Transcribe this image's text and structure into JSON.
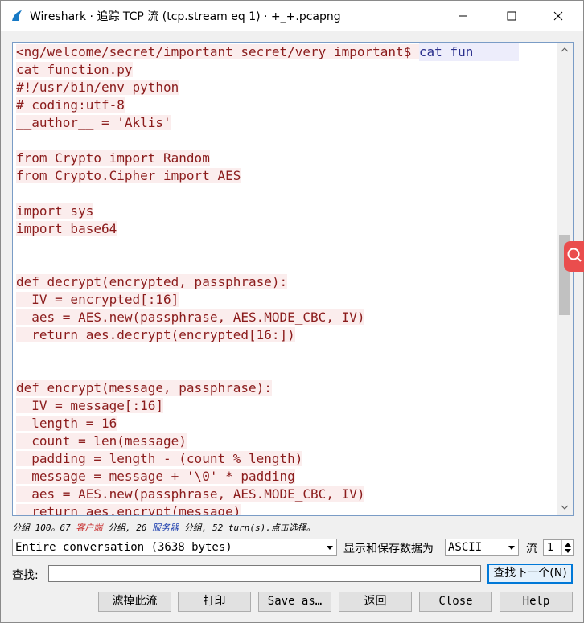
{
  "window": {
    "title": "Wireshark · 追踪 TCP 流 (tcp.stream eq 1) · +_+.pcapng",
    "icons": {
      "app": "wireshark-fin-icon",
      "minimize": "minimize-icon",
      "maximize": "maximize-icon",
      "close": "close-icon"
    }
  },
  "stream": {
    "first_line_client": "<ng/welcome/secret/important_secret/very_important$ ",
    "first_line_server": "cat fun",
    "lines": [
      "cat function.py",
      "#!/usr/bin/env python",
      "# coding:utf-8",
      "__author__ = 'Aklis'",
      "",
      "from Crypto import Random",
      "from Crypto.Cipher import AES",
      "",
      "import sys",
      "import base64",
      "",
      "",
      "def decrypt(encrypted, passphrase):",
      "  IV = encrypted[:16]",
      "  aes = AES.new(passphrase, AES.MODE_CBC, IV)",
      "  return aes.decrypt(encrypted[16:])",
      "",
      "",
      "def encrypt(message, passphrase):",
      "  IV = message[:16]",
      "  length = 16",
      "  count = len(message)",
      "  padding = length - (count % length)",
      "  message = message + '\\0' * padding",
      "  aes = AES.new(passphrase, AES.MODE_CBC, IV)",
      "  return aes.encrypt(message)"
    ],
    "colors": {
      "client_text": "#8b1c1c",
      "client_bg": "#fbeded",
      "server_text": "#2a2f8c",
      "server_bg": "#ededfb"
    }
  },
  "status": {
    "prefix": "分组 100。67 ",
    "client": "客户端",
    "middle": " 分组, 26 ",
    "server": "服务器",
    "suffix": " 分组, 52 turn(s).点击选择。"
  },
  "controls": {
    "conversation": "Entire conversation (3638 bytes)",
    "show_save_label": "显示和保存数据为",
    "format": "ASCII",
    "stream_label": "流",
    "stream_number": "1",
    "find_label": "查找:",
    "find_value": "",
    "find_next": "查找下一个(N)"
  },
  "buttons": {
    "filter_out": "滤掉此流",
    "print": "打印",
    "save_as": "Save as…",
    "back": "返回",
    "close": "Close",
    "help": "Help"
  },
  "floating": {
    "icon": "search-icon",
    "color": "#ea4d4d"
  }
}
